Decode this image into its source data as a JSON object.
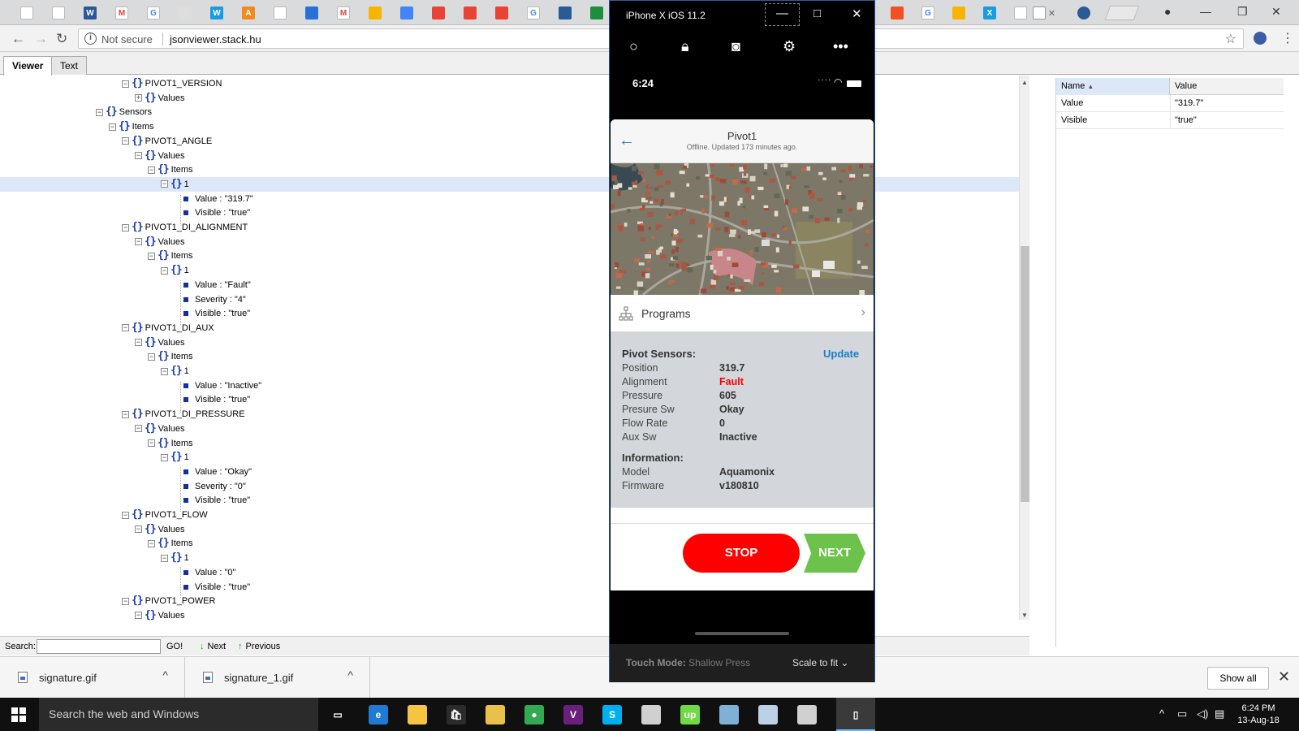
{
  "browser": {
    "url_prefix": "Not secure",
    "url": "jsonviewer.stack.hu",
    "tab_close": "✕"
  },
  "viewer": {
    "tabs": [
      "Viewer",
      "Text"
    ],
    "search_label": "Search:",
    "go_label": "GO!",
    "next_label": "Next",
    "previous_label": "Previous"
  },
  "tree": [
    {
      "level": 0,
      "type": "obj",
      "label": "PIVOT1_VERSION"
    },
    {
      "level": 1,
      "type": "objc",
      "label": "Values"
    },
    {
      "level": -2,
      "type": "obj",
      "label": "Sensors"
    },
    {
      "level": -1,
      "type": "obj",
      "label": "Items"
    },
    {
      "level": 0,
      "type": "obj",
      "label": "PIVOT1_ANGLE"
    },
    {
      "level": 1,
      "type": "obj",
      "label": "Values"
    },
    {
      "level": 2,
      "type": "obj",
      "label": "Items"
    },
    {
      "level": 3,
      "type": "obj",
      "label": "1",
      "selected": true
    },
    {
      "level": 4,
      "type": "leaf",
      "label": "Value : \"319.7\""
    },
    {
      "level": 4,
      "type": "leaf",
      "label": "Visible : \"true\""
    },
    {
      "level": 0,
      "type": "obj",
      "label": "PIVOT1_DI_ALIGNMENT"
    },
    {
      "level": 1,
      "type": "obj",
      "label": "Values"
    },
    {
      "level": 2,
      "type": "obj",
      "label": "Items"
    },
    {
      "level": 3,
      "type": "obj",
      "label": "1"
    },
    {
      "level": 4,
      "type": "leaf",
      "label": "Value : \"Fault\""
    },
    {
      "level": 4,
      "type": "leaf",
      "label": "Severity : \"4\""
    },
    {
      "level": 4,
      "type": "leaf",
      "label": "Visible : \"true\""
    },
    {
      "level": 0,
      "type": "obj",
      "label": "PIVOT1_DI_AUX"
    },
    {
      "level": 1,
      "type": "obj",
      "label": "Values"
    },
    {
      "level": 2,
      "type": "obj",
      "label": "Items"
    },
    {
      "level": 3,
      "type": "obj",
      "label": "1"
    },
    {
      "level": 4,
      "type": "leaf",
      "label": "Value : \"Inactive\""
    },
    {
      "level": 4,
      "type": "leaf",
      "label": "Visible : \"true\""
    },
    {
      "level": 0,
      "type": "obj",
      "label": "PIVOT1_DI_PRESSURE"
    },
    {
      "level": 1,
      "type": "obj",
      "label": "Values"
    },
    {
      "level": 2,
      "type": "obj",
      "label": "Items"
    },
    {
      "level": 3,
      "type": "obj",
      "label": "1"
    },
    {
      "level": 4,
      "type": "leaf",
      "label": "Value : \"Okay\""
    },
    {
      "level": 4,
      "type": "leaf",
      "label": "Severity : \"0\""
    },
    {
      "level": 4,
      "type": "leaf",
      "label": "Visible : \"true\""
    },
    {
      "level": 0,
      "type": "obj",
      "label": "PIVOT1_FLOW"
    },
    {
      "level": 1,
      "type": "obj",
      "label": "Values"
    },
    {
      "level": 2,
      "type": "obj",
      "label": "Items"
    },
    {
      "level": 3,
      "type": "obj",
      "label": "1"
    },
    {
      "level": 4,
      "type": "leaf",
      "label": "Value : \"0\""
    },
    {
      "level": 4,
      "type": "leaf",
      "label": "Visible : \"true\""
    },
    {
      "level": 0,
      "type": "obj",
      "label": "PIVOT1_POWER"
    },
    {
      "level": 1,
      "type": "obj",
      "label": "Values"
    }
  ],
  "properties": {
    "col_name": "Name",
    "col_value": "Value",
    "rows": [
      {
        "name": "Value",
        "value": "\"319.7\""
      },
      {
        "name": "Visible",
        "value": "\"true\""
      }
    ]
  },
  "simulator": {
    "title": "iPhone X iOS 11.2",
    "touch_mode_label": "Touch Mode:",
    "touch_mode_value": "Shallow Press",
    "scale_label": "Scale to fit"
  },
  "phone": {
    "time": "6:24",
    "app_title": "Pivot1",
    "app_subtitle": "Offline. Updated 173 minutes ago.",
    "programs_label": "Programs",
    "sensors_heading": "Pivot Sensors:",
    "update_label": "Update",
    "sensors": [
      {
        "key": "Position",
        "value": "319.7",
        "color": "#333333"
      },
      {
        "key": "Alignment",
        "value": "Fault",
        "color": "#ff0000"
      },
      {
        "key": "Pressure",
        "value": "605",
        "color": "#333333"
      },
      {
        "key": "Presure Sw",
        "value": "Okay",
        "color": "#333333"
      },
      {
        "key": "Flow Rate",
        "value": "0",
        "color": "#333333"
      },
      {
        "key": "Aux Sw",
        "value": "Inactive",
        "color": "#333333"
      }
    ],
    "info_heading": "Information:",
    "info": [
      {
        "key": "Model",
        "value": "Aquamonix"
      },
      {
        "key": "Firmware",
        "value": "v180810"
      }
    ],
    "stop_label": "STOP",
    "next_label": "NEXT"
  },
  "downloads": {
    "items": [
      "signature.gif",
      "signature_1.gif"
    ],
    "show_all": "Show all"
  },
  "taskbar": {
    "search_placeholder": "Search the web and Windows",
    "time": "6:24 PM",
    "date": "13-Aug-18"
  },
  "colors": {
    "stop": "#ff0000",
    "next": "#6cc24a",
    "fault": "#ff0000",
    "update_link": "#1a7fc8"
  }
}
